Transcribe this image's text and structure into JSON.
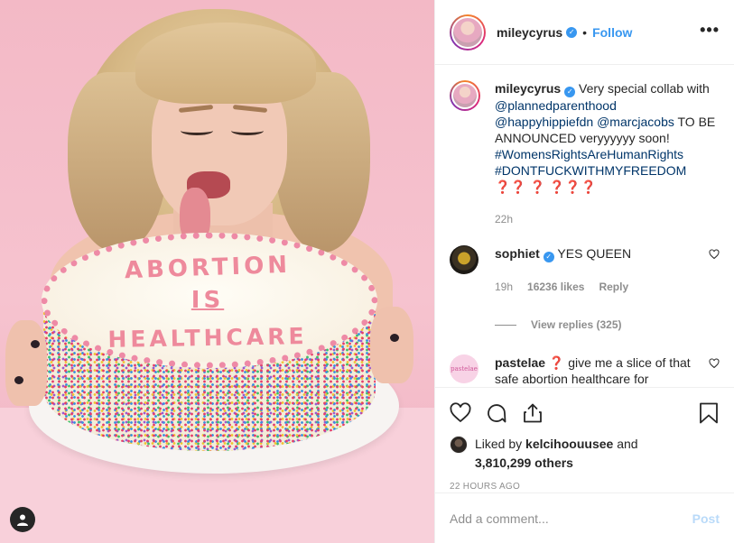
{
  "post": {
    "username": "mileycyrus",
    "verified_glyph": "✓",
    "separator": "•",
    "follow_label": "Follow",
    "more_label": "•••",
    "cake_text": [
      "ABORTION",
      "IS",
      "HEALTHCARE"
    ]
  },
  "caption": {
    "username": "mileycyrus",
    "text_1": " Very special collab with ",
    "mention_1": "@plannedparenthood",
    "mention_2": "@happyhippiefdn",
    "mention_3": "@marcjacobs",
    "text_2": " TO BE ANNOUNCED veryyyyyy soon! ",
    "hashtag_1": "#WomensRightsAreHumanRights",
    "hashtag_2": "#DONTFUCKWITHMYFREEDOM",
    "emoji_tail": " ❓❓ ❓ ❓❓❓",
    "time": "22h"
  },
  "comments": [
    {
      "username": "sophiet",
      "text": " YES QUEEN",
      "time": "19h",
      "likes": "16236 likes",
      "reply_label": "Reply",
      "view_replies": "View replies (325)"
    },
    {
      "username": "pastelae",
      "text": " ❓ give me a slice of that safe abortion healthcare for",
      "avatar_text": "pastelae"
    }
  ],
  "likes": {
    "prefix": "Liked by ",
    "user": "kelcihoouusee",
    "middle": " and",
    "count": "3,810,299 others"
  },
  "timestamp": "22 HOURS AGO",
  "add_comment": {
    "placeholder": "Add a comment...",
    "post_label": "Post"
  },
  "colors": {
    "accent": "#3897f0",
    "link": "#003569",
    "muted": "#8e8e8e",
    "photo_bg": "#f3b9c6"
  },
  "icons": [
    "user-tag-icon",
    "verified-icon",
    "more-icon",
    "heart-icon",
    "comment-icon",
    "share-icon",
    "bookmark-icon"
  ]
}
